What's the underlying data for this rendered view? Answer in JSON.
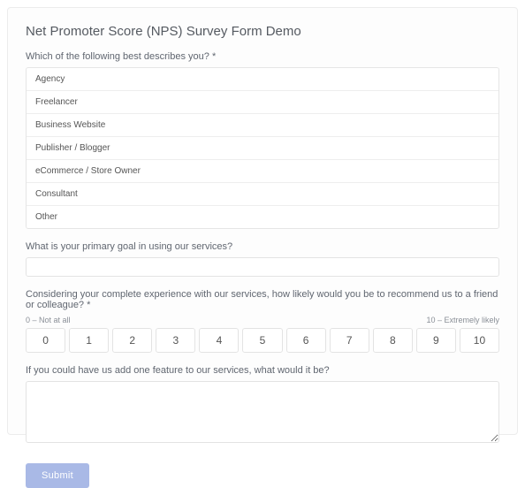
{
  "form": {
    "title": "Net Promoter Score (NPS) Survey Form Demo",
    "q1": {
      "label": "Which of the following best describes you? *",
      "options": [
        "Agency",
        "Freelancer",
        "Business Website",
        "Publisher / Blogger",
        "eCommerce / Store Owner",
        "Consultant",
        "Other"
      ]
    },
    "q2": {
      "label": "What is your primary goal in using our services?",
      "value": ""
    },
    "q3": {
      "label": "Considering your complete experience with our services, how likely would you be to recommend us to a friend or colleague? *",
      "low_label": "0 – Not at all",
      "high_label": "10 – Extremely likely",
      "scale": [
        "0",
        "1",
        "2",
        "3",
        "4",
        "5",
        "6",
        "7",
        "8",
        "9",
        "10"
      ]
    },
    "q4": {
      "label": "If you could have us add one feature to our services, what would it be?",
      "value": ""
    },
    "submit_label": "Submit"
  }
}
